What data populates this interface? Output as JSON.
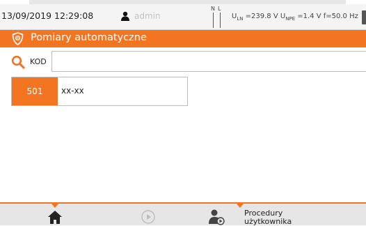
{
  "status": {
    "datetime": "13/09/2019 12:29:08",
    "user": "admin",
    "indicator_n": "N",
    "indicator_l": "L",
    "uln_prefix": "U",
    "uln_sub": "LN",
    "uln_value": " =239.8 V ",
    "unpe_prefix": "U",
    "unpe_sub": "NPE",
    "unpe_value": " =1.4 V ",
    "freq": "f=50.0 Hz"
  },
  "title": "Pomiary automatyczne",
  "search": {
    "label": "KOD",
    "value": ""
  },
  "list": [
    {
      "code": "501",
      "name": "xx-xx"
    }
  ],
  "bottom": {
    "procedures_line1": "Procedury",
    "procedures_line2": "użytkownika"
  },
  "colors": {
    "accent": "#f37421",
    "statusbar": "#f4f4f4",
    "bottombar": "#e6e6e6"
  },
  "icons": [
    "user-icon",
    "shield-icon",
    "search-icon",
    "home-icon",
    "play-icon",
    "user-procedure-icon",
    "battery-icon"
  ]
}
